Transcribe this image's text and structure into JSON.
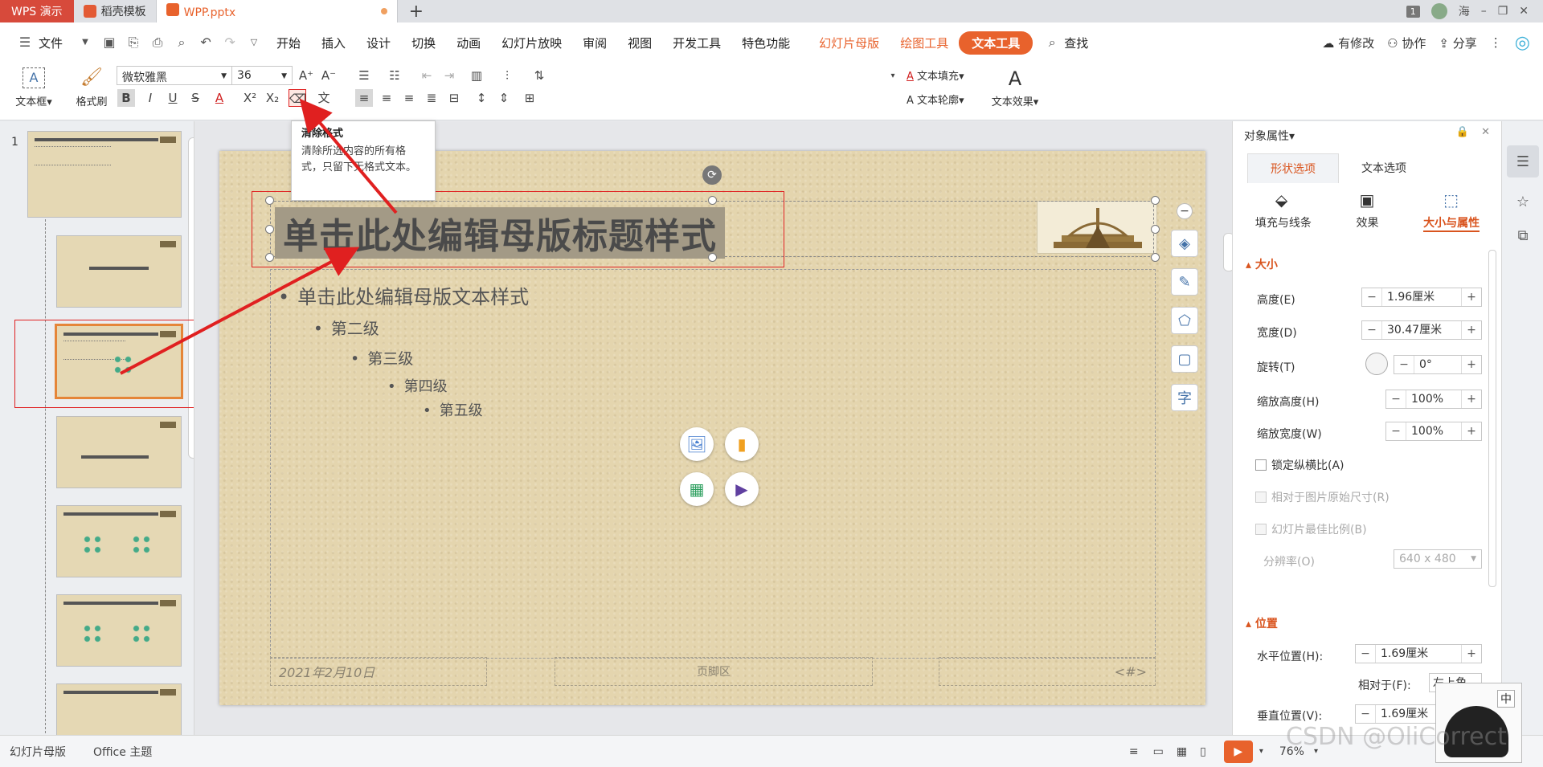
{
  "tabbar": {
    "app": "WPS 演示",
    "tab1": "稻壳模板",
    "tab2": "WPP.pptx",
    "page_badge": "1",
    "user": "海"
  },
  "menu": {
    "file": "文件",
    "items": [
      "开始",
      "插入",
      "设计",
      "切换",
      "动画",
      "幻灯片放映",
      "审阅",
      "视图",
      "开发工具",
      "特色功能"
    ],
    "slide_master": "幻灯片母版",
    "draw_tools": "绘图工具",
    "text_tools": "文本工具",
    "search": "查找",
    "changes": "有修改",
    "collab": "协作",
    "share": "分享"
  },
  "ribbon": {
    "textbox": "文本框",
    "format_painter": "格式刷",
    "font_name": "微软雅黑",
    "font_size": "36",
    "text_fill": "文本填充",
    "text_outline": "文本轮廓",
    "text_effect": "文本效果",
    "gallery_letter": "A"
  },
  "tooltip": {
    "title": "清除格式",
    "body": "清除所选内容的所有格式，只留下无格式文本。"
  },
  "slide": {
    "title": "单击此处编辑母版标题样式",
    "level1": "单击此处编辑母版文本样式",
    "level2": "第二级",
    "level3": "第三级",
    "level4": "第四级",
    "level5": "第五级",
    "date": "2021年2月10日",
    "footer": "页脚区",
    "number": "<#>"
  },
  "thumbnails": {
    "first_number": "1"
  },
  "panel": {
    "header": "对象属性",
    "tab_shape": "形状选项",
    "tab_text": "文本选项",
    "sub_fill": "填充与线条",
    "sub_effect": "效果",
    "sub_size": "大小与属性",
    "sec_size": "大小",
    "height_label": "高度(E)",
    "height_value": "1.96厘米",
    "width_label": "宽度(D)",
    "width_value": "30.47厘米",
    "rotation_label": "旋转(T)",
    "rotation_value": "0°",
    "scale_h_label": "缩放高度(H)",
    "scale_h_value": "100%",
    "scale_w_label": "缩放宽度(W)",
    "scale_w_value": "100%",
    "lock_ratio": "锁定纵横比(A)",
    "relative_original": "相对于图片原始尺寸(R)",
    "best_scale": "幻灯片最佳比例(B)",
    "resolution_label": "分辨率(O)",
    "resolution_value": "640 x 480",
    "sec_position": "位置",
    "hpos_label": "水平位置(H):",
    "hpos_value": "1.69厘米",
    "relative_to": "相对于(F):",
    "relative_value": "左上角",
    "vpos_label": "垂直位置(V):",
    "vpos_value": "1.69厘米"
  },
  "status": {
    "mode": "幻灯片母版",
    "theme": "Office 主题",
    "zoom": "76%"
  },
  "watermark": "CSDN @OliCorrect",
  "ime": "中",
  "colors": {
    "accent": "#e8622c",
    "app_red": "#d74a3b",
    "annotation_red": "#e02020",
    "slide_bg": "#e4d5ae"
  }
}
